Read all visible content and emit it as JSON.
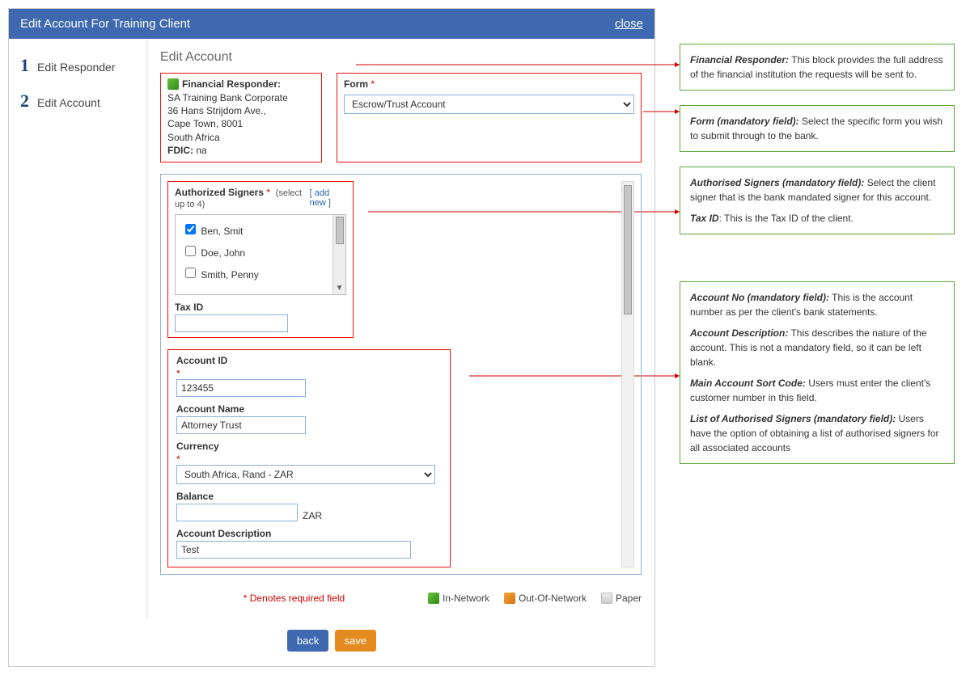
{
  "titlebar": {
    "title": "Edit Account For Training Client",
    "close": "close"
  },
  "sidebar": {
    "steps": [
      {
        "num": "1",
        "label": "Edit Responder"
      },
      {
        "num": "2",
        "label": "Edit Account"
      }
    ]
  },
  "main": {
    "heading": "Edit Account",
    "responder": {
      "title": "Financial Responder:",
      "line1": "SA Training Bank Corporate",
      "line2": "36 Hans Strijdom Ave.,",
      "line3": "Cape Town, 8001",
      "line4": "South Africa",
      "fdic_label": "FDIC:",
      "fdic_value": "na"
    },
    "form": {
      "label": "Form",
      "value": "Escrow/Trust Account"
    },
    "signers": {
      "label": "Authorized Signers",
      "hint": "(select up to 4)",
      "addnew": "[ add new ]",
      "items": [
        {
          "name": "Ben, Smit",
          "checked": true
        },
        {
          "name": "Doe, John",
          "checked": false
        },
        {
          "name": "Smith, Penny",
          "checked": false
        }
      ],
      "taxid_label": "Tax ID",
      "taxid_value": ""
    },
    "account": {
      "id_label": "Account ID",
      "id_value": "123455",
      "name_label": "Account Name",
      "name_value": "Attorney Trust",
      "currency_label": "Currency",
      "currency_value": "South Africa, Rand - ZAR",
      "balance_label": "Balance",
      "balance_value": "",
      "balance_suffix": "ZAR",
      "desc_label": "Account Description",
      "desc_value": "Test"
    },
    "denotes": "* Denotes required field",
    "legend": {
      "in_network": "In-Network",
      "out_of_network": "Out-Of-Network",
      "paper": "Paper"
    },
    "buttons": {
      "back": "back",
      "save": "save"
    }
  },
  "notes": {
    "n1": {
      "lead": "Financial Responder:",
      "text": " This block provides the full address of the financial institution the requests will be sent to."
    },
    "n2": {
      "lead": "Form (mandatory field):",
      "text": " Select the specific form you wish to submit through to the bank."
    },
    "n3": {
      "lead1": "Authorised Signers (mandatory field):",
      "text1": " Select the client signer that is the bank mandated signer for this account.",
      "lead2": "Tax ID",
      "text2": ": This is the Tax ID of the client."
    },
    "n4": {
      "lead1": "Account No (mandatory field):",
      "text1": " This is the account number as per the client's bank statements.",
      "lead2": "Account Description:",
      "text2": " This describes the nature of the account. This is not a mandatory field, so it can be left blank.",
      "lead3": "Main Account Sort Code:",
      "text3": " Users must enter the client's customer number in this field.",
      "lead4": "List of Authorised Signers (mandatory field):",
      "text4": " Users have the option of obtaining a list of authorised signers for all associated accounts"
    }
  }
}
